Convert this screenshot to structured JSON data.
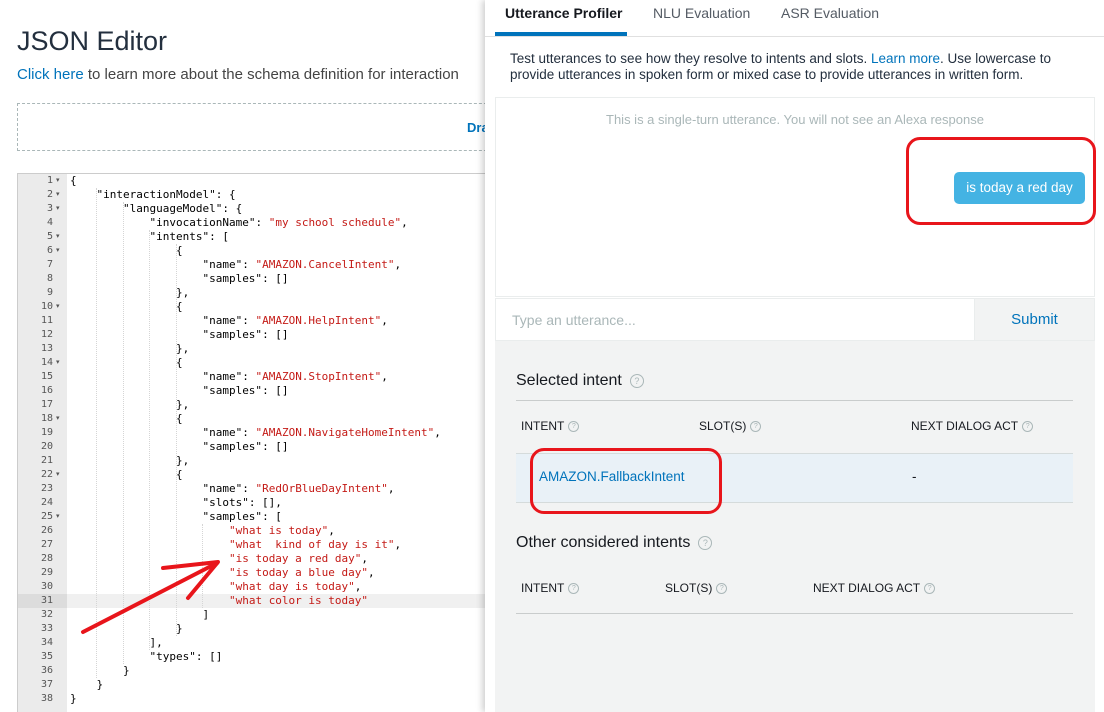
{
  "left": {
    "title": "JSON Editor",
    "schema_link": "Click here",
    "schema_text": " to learn more about the schema definition for interaction",
    "drop_zone_text": "Dra",
    "code_lines": [
      "{",
      "    \"interactionModel\": {",
      "        \"languageModel\": {",
      "            \"invocationName\": \"my school schedule\",",
      "            \"intents\": [",
      "                {",
      "                    \"name\": \"AMAZON.CancelIntent\",",
      "                    \"samples\": []",
      "                },",
      "                {",
      "                    \"name\": \"AMAZON.HelpIntent\",",
      "                    \"samples\": []",
      "                },",
      "                {",
      "                    \"name\": \"AMAZON.StopIntent\",",
      "                    \"samples\": []",
      "                },",
      "                {",
      "                    \"name\": \"AMAZON.NavigateHomeIntent\",",
      "                    \"samples\": []",
      "                },",
      "                {",
      "                    \"name\": \"RedOrBlueDayIntent\",",
      "                    \"slots\": [],",
      "                    \"samples\": [",
      "                        \"what is today\",",
      "                        \"what  kind of day is it\",",
      "                        \"is today a red day\",",
      "                        \"is today a blue day\",",
      "                        \"what day is today\",",
      "                        \"what color is today\"",
      "                    ]",
      "                }",
      "            ],",
      "            \"types\": []",
      "        }",
      "    }",
      "}"
    ],
    "fold_lines": [
      1,
      2,
      3,
      5,
      6,
      10,
      14,
      18,
      22,
      25
    ],
    "active_line": 31
  },
  "right": {
    "tabs": [
      {
        "label": "Utterance Profiler",
        "active": true
      },
      {
        "label": "NLU Evaluation",
        "active": false
      },
      {
        "label": "ASR Evaluation",
        "active": false
      }
    ],
    "desc_before": "Test utterances to see how they resolve to intents and slots. ",
    "desc_link": "Learn more",
    "desc_after": ". Use lowercase to provide utterances in spoken form or mixed case to provide utterances in written form.",
    "chat_note": "This is a single-turn utterance. You will not see an Alexa response",
    "user_utterance": "is today a red day",
    "input_placeholder": "Type an utterance...",
    "submit_label": "Submit",
    "selected_intent": {
      "title": "Selected intent",
      "columns": [
        "INTENT",
        "SLOT(S)",
        "NEXT DIALOG ACT"
      ],
      "row": {
        "intent": "AMAZON.FallbackIntent",
        "slots": "",
        "next_dialog_act": "-"
      }
    },
    "other_intents": {
      "title": "Other considered intents",
      "columns": [
        "INTENT",
        "SLOT(S)",
        "NEXT DIALOG ACT"
      ]
    },
    "info_glyph": "?"
  },
  "colors": {
    "accent": "#0073bb",
    "bubble": "#44b3e3",
    "annotation": "#e8151b",
    "string": "#c41a16"
  }
}
